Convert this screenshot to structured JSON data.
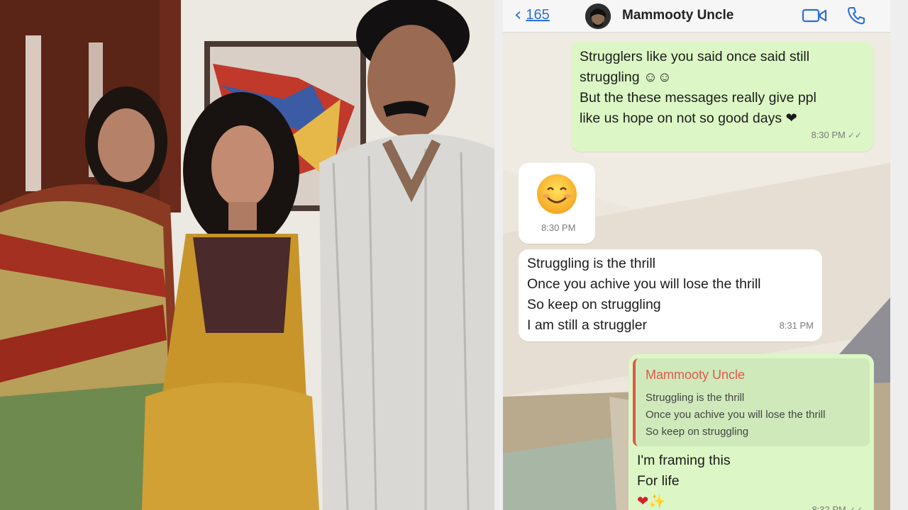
{
  "header": {
    "back_count": "165",
    "contact_name": "Mammooty Uncle",
    "icons": [
      "chevron-left-icon",
      "video-call-icon",
      "phone-call-icon"
    ]
  },
  "messages": [
    {
      "direction": "outgoing",
      "lines": [
        "Strugglers like you said once said still",
        "struggling ☺☺",
        "But the these messages really give ppl",
        "like us hope on not so good days ❤"
      ],
      "time": "8:30 PM"
    },
    {
      "direction": "incoming",
      "emoji": "😊",
      "time": "8:30 PM"
    },
    {
      "direction": "incoming",
      "lines": [
        "Struggling is the thrill",
        "Once you achive you will lose the thrill",
        "So keep on struggling",
        "I am still a struggler"
      ],
      "time": "8:31 PM"
    },
    {
      "direction": "outgoing",
      "quote": {
        "name": "Mammooty Uncle",
        "lines": [
          "Struggling is the thrill",
          "Once you achive you will lose the thrill",
          "So keep on struggling"
        ]
      },
      "lines": [
        "I'm framing this",
        "For life",
        "❤✨"
      ],
      "time": "8:32 PM"
    }
  ],
  "colors": {
    "outgoing": "#dcf7c5",
    "incoming": "#ffffff",
    "accent": "#2a6fd8",
    "quote_name": "#e2574c"
  }
}
